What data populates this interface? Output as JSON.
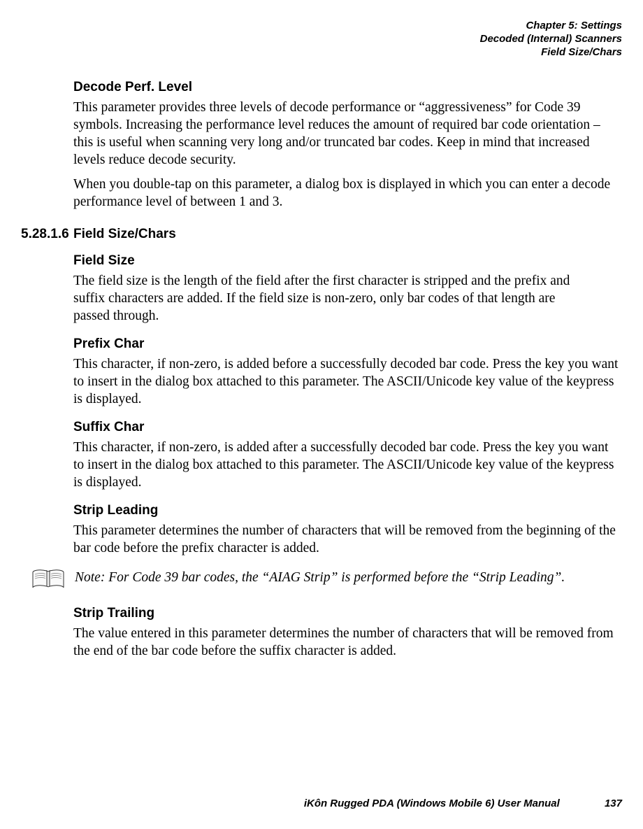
{
  "header": {
    "line1": "Chapter 5: Settings",
    "line2": "Decoded (Internal) Scanners",
    "line3": "Field Size/Chars"
  },
  "sec1": {
    "h": "Decode Perf. Level",
    "p1": "This parameter provides three levels of decode performance or “aggressiveness” for Code 39 symbols. Increasing the performance level reduces the amount of required bar code orientation – this is useful when scanning very long and/or truncated bar codes. Keep in mind that increased levels reduce decode security.",
    "p2": "When you double-tap on this parameter, a dialog box is displayed in which you can enter a decode performance level of between 1 and 3."
  },
  "sec2": {
    "num": "5.28.1.6",
    "title": "Field Size/Chars",
    "fs_h": "Field Size",
    "fs_p": "The field size is the length of the field after the first character is stripped and the prefix and suffix characters are added. If the field size is non-zero, only bar codes of that length are passed through.",
    "pc_h": "Prefix Char",
    "pc_p": "This character, if non-zero, is added before a successfully decoded bar code. Press the key you want to insert in the dialog box attached to this parameter. The ASCII/Unicode key value of the keypress is displayed.",
    "sc_h": "Suffix Char",
    "sc_p": "This character, if non-zero, is added after a successfully decoded bar code. Press the key you want to insert in the dialog box attached to this parameter. The ASCII/Unicode key value of the keypress is displayed.",
    "sl_h": "Strip Leading",
    "sl_p": "This parameter determines the number of characters that will be removed from the beginning of the bar code before the prefix character is added.",
    "note_label": "Note:",
    "note_text": "For Code 39 bar codes, the “AIAG Strip” is performed before the “Strip Leading”.",
    "st_h": "Strip Trailing",
    "st_p": "The value entered in this parameter determines the number of characters that will be removed from the end of the bar code before the suffix character is added."
  },
  "footer": {
    "manual": "iKôn Rugged PDA (Windows Mobile 6) User Manual",
    "page": "137"
  }
}
